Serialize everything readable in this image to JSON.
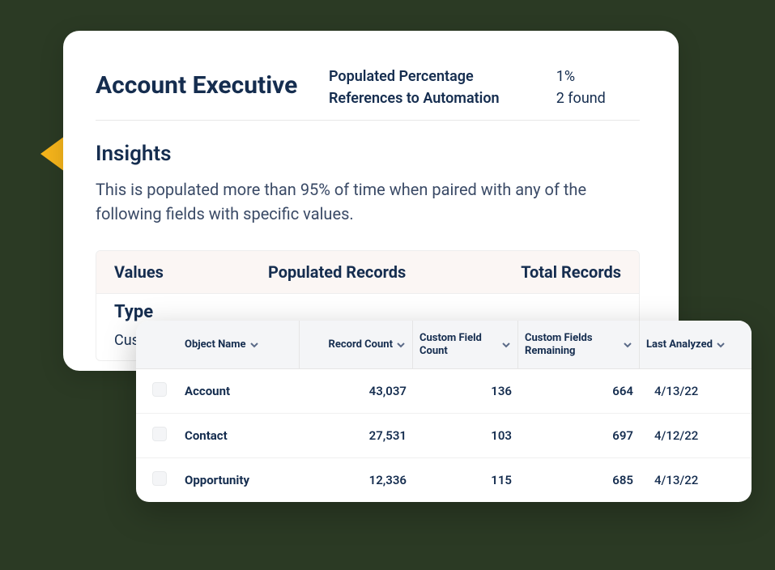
{
  "back": {
    "title": "Account Executive",
    "meta": {
      "populated_label": "Populated Percentage",
      "populated_value": "1%",
      "refs_label": "References to Automation",
      "refs_value": "2 found"
    },
    "insights_heading": "Insights",
    "insights_text": "This is populated more than 95% of time when paired with any of the following fields with specific values.",
    "inner_table": {
      "headers": {
        "values": "Values",
        "populated": "Populated Records",
        "total": "Total Records"
      },
      "type_label": "Type",
      "customer_label": "Custo"
    }
  },
  "front": {
    "columns": {
      "object_name": "Object Name",
      "record_count": "Record Count",
      "custom_field_count": "Custom Field Count",
      "custom_fields_remaining": "Custom Fields Remaining",
      "last_analyzed": "Last Analyzed"
    },
    "rows": [
      {
        "name": "Account",
        "record_count": "43,037",
        "cfc": "136",
        "cfr": "664",
        "la": "4/13/22"
      },
      {
        "name": "Contact",
        "record_count": "27,531",
        "cfc": "103",
        "cfr": "697",
        "la": "4/12/22"
      },
      {
        "name": "Opportunity",
        "record_count": "12,336",
        "cfc": "115",
        "cfr": "685",
        "la": "4/13/22"
      }
    ]
  }
}
